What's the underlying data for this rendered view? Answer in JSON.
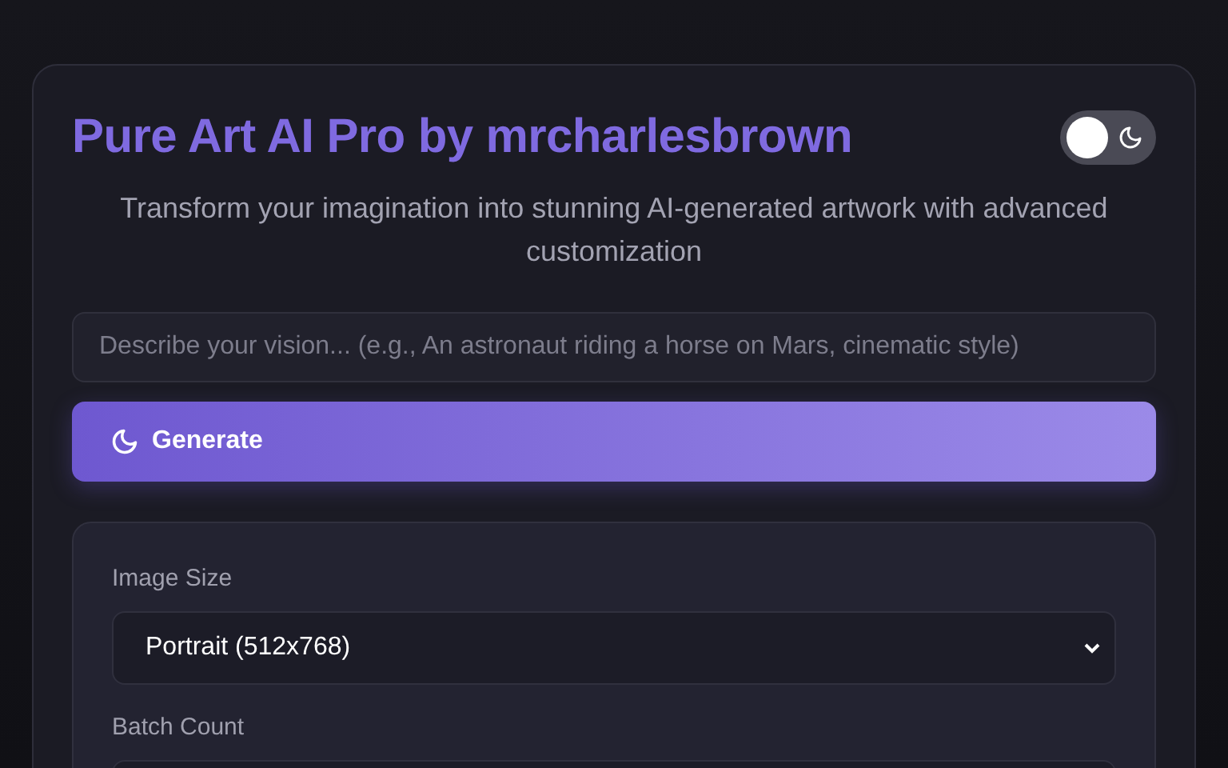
{
  "header": {
    "title": "Pure Art AI Pro by mrcharlesbrown",
    "theme_toggle": {
      "on": false
    }
  },
  "subtitle": "Transform your imagination into stunning AI-generated artwork with advanced customization",
  "prompt": {
    "placeholder": "Describe your vision... (e.g., An astronaut riding a horse on Mars, cinematic style)"
  },
  "generate_button": {
    "label": "Generate"
  },
  "settings": [
    {
      "label": "Image Size",
      "value": "Portrait (512x768)"
    },
    {
      "label": "Batch Count"
    }
  ]
}
